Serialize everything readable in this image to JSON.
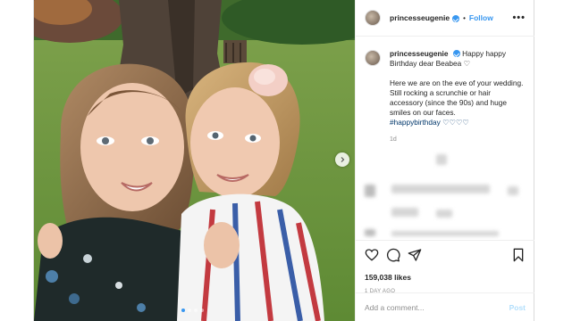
{
  "post": {
    "username": "princesseugenie",
    "follow_label": "Follow",
    "separator": "•",
    "more_label": "•••",
    "caption_line1": "Happy happy Birthday dear Beabea ",
    "caption_emoji1": "♡",
    "caption_para2": "Here we are on the eve of your wedding. Still rocking a scrunchie or hair accessory (since the 90s) and huge smiles on our faces.",
    "hashtag": "#happybirthday",
    "hashtag_emoji": "♡♡♡♡",
    "caption_age": "1d",
    "likes": "159,038 likes",
    "date": "1 DAY AGO",
    "comment_placeholder": "Add a comment...",
    "post_label": "Post"
  },
  "colors": {
    "accent": "#3897f0",
    "post_disabled": "#b2dffc",
    "hashtag": "#00376b",
    "muted": "#8e8e8e"
  },
  "icons": [
    "verified-badge-icon",
    "chevron-right-icon",
    "heart-icon",
    "comment-icon",
    "share-icon",
    "bookmark-icon"
  ],
  "carousel": {
    "count": 4,
    "active_index": 0
  }
}
